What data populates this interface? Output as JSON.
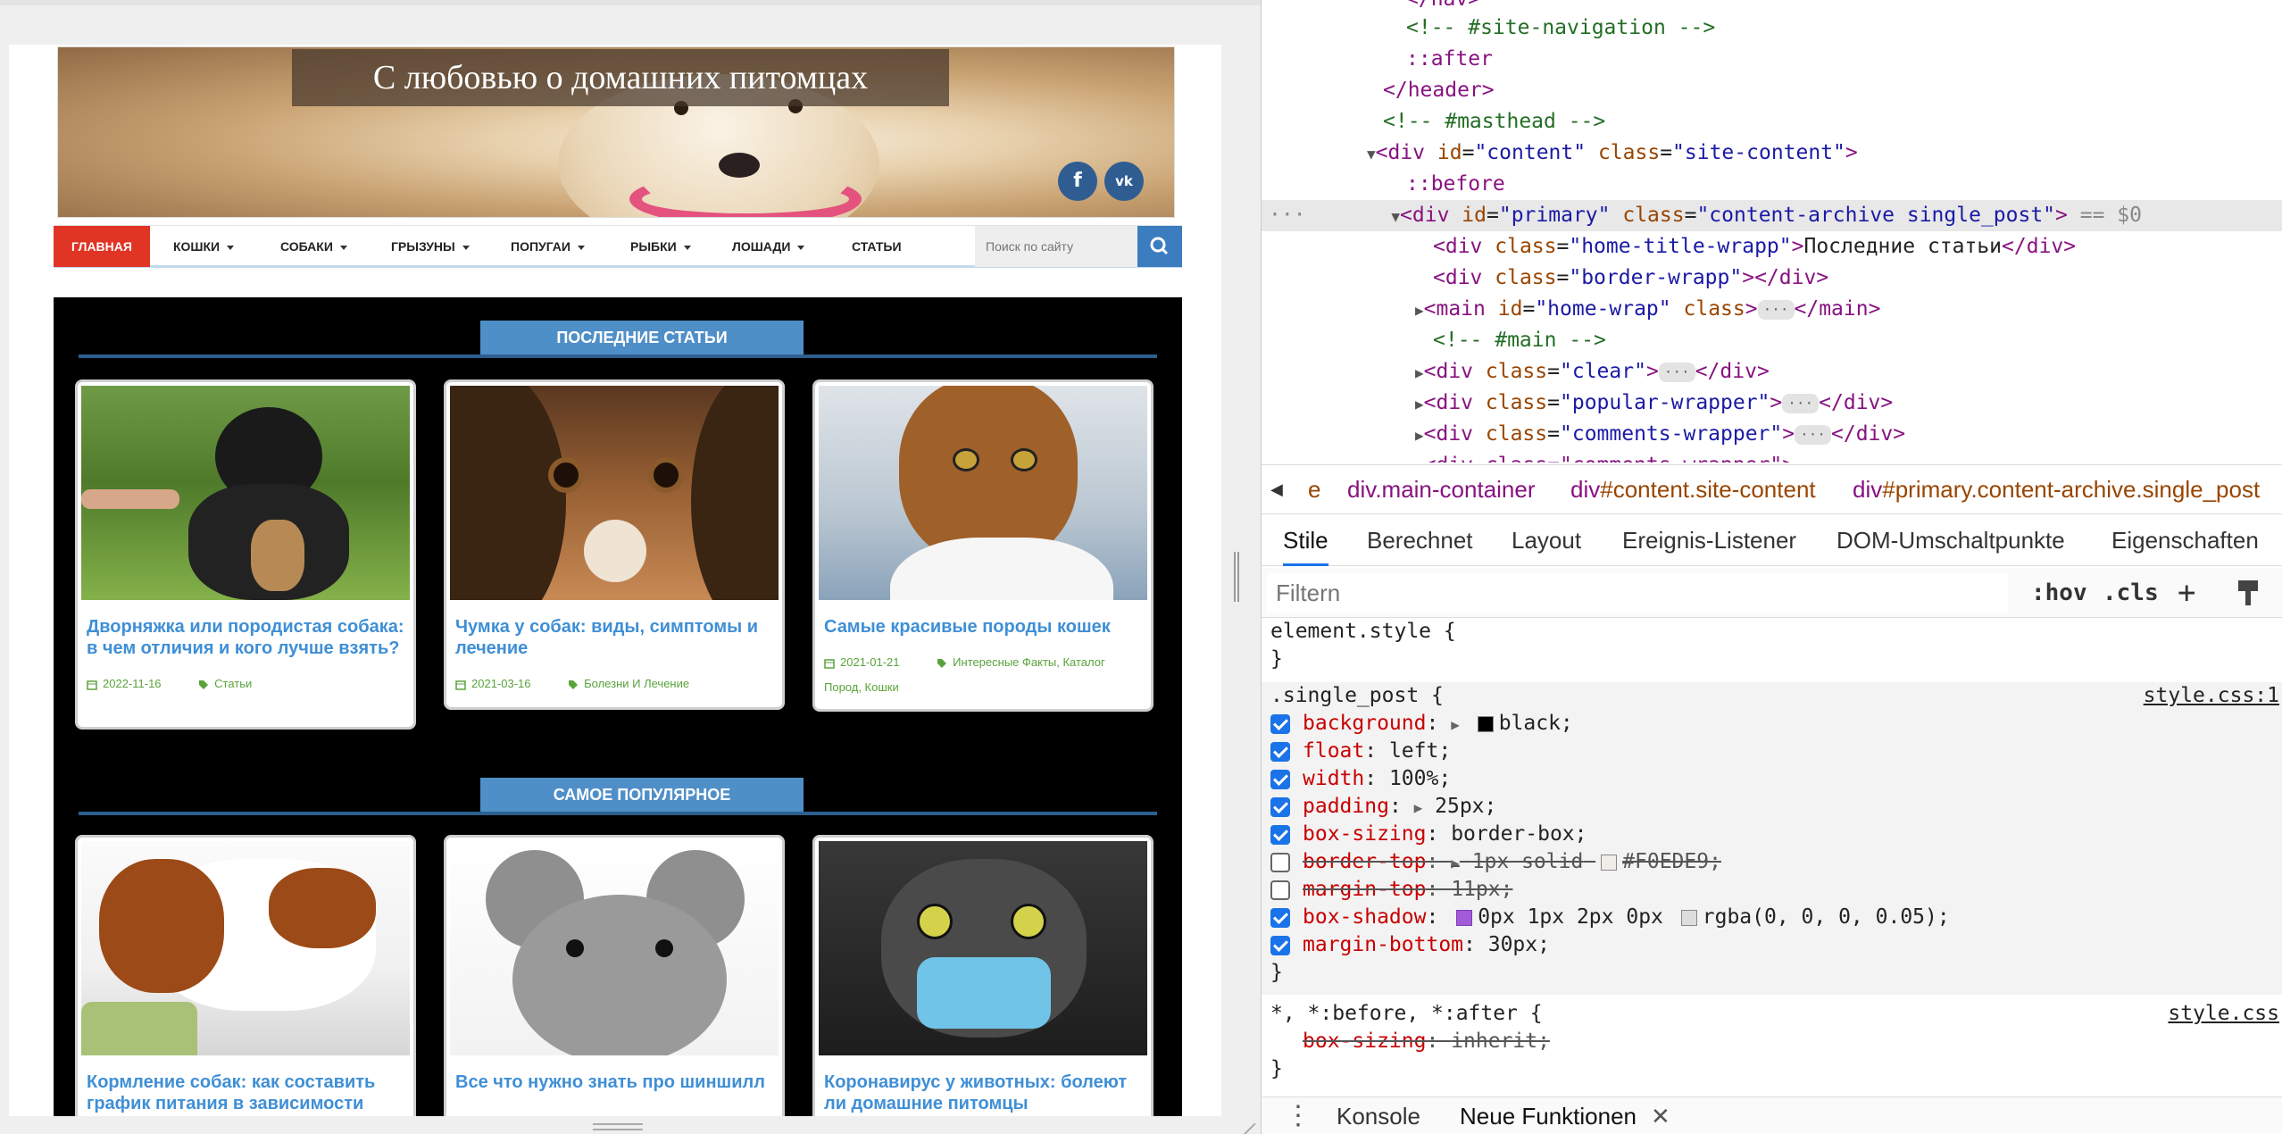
{
  "site": {
    "title": "С любовью о домашних питомцах",
    "social": {
      "fb": "f",
      "vk": "vk"
    },
    "nav": {
      "home": "Главная",
      "items": [
        "Кошки",
        "Собаки",
        "Грызуны",
        "Попугаи",
        "Рыбки",
        "Лошади",
        "Статьи"
      ],
      "search_placeholder": "Поиск по сайту"
    },
    "sections": {
      "latest": "ПОСЛЕДНИЕ СТАТЬИ",
      "popular": "САМОЕ ПОПУЛЯРНОЕ"
    },
    "cards": [
      {
        "title": "Дворняжка или породистая собака: в чем отличия и кого лучше взять?",
        "date": "2022-11-16",
        "category": "Статьи"
      },
      {
        "title": "Чумка у собак: виды, симптомы и лечение",
        "date": "2021-03-16",
        "category": "Болезни И Лечение"
      },
      {
        "title": "Самые красивые породы кошек",
        "date": "2021-01-21",
        "category": "Интересные Факты, Каталог Пород, Кошки"
      },
      {
        "title": "Кормление собак: как составить график питания в зависимости",
        "date": "",
        "category": ""
      },
      {
        "title": "Все что нужно знать про шиншилл",
        "date": "",
        "category": ""
      },
      {
        "title": "Коронавирус у животных: болеют ли домашние питомцы",
        "date": "",
        "category": ""
      }
    ]
  },
  "devtools": {
    "dom": {
      "l0": "</nav>",
      "l1": "<!-- #site-navigation -->",
      "l2": "::after",
      "l3": "</header>",
      "l4": "<!-- #masthead -->",
      "l5_tag": "<div",
      "l5_a1": "id",
      "l5_v1": "\"content\"",
      "l5_a2": "class",
      "l5_v2": "\"site-content\"",
      "l6": "::before",
      "l7_a1": "id",
      "l7_v1": "\"primary\"",
      "l7_a2": "class",
      "l7_v2": "\"content-archive single_post\"",
      "l7_eq": "== $0",
      "l8_v": "\"home-title-wrapp\"",
      "l8_text": "Последние статьи",
      "l9_v": "\"border-wrapp\"",
      "l10_a1": "id",
      "l10_v1": "\"home-wrap\"",
      "l10_a2": "class",
      "l11": "<!-- #main -->",
      "l12_v": "\"clear\"",
      "l13_v": "\"popular-wrapper\"",
      "l14_v": "\"comments-wrapper\"",
      "l15": "<div class=\"comments-wrapper\">"
    },
    "breadcrumbs": [
      {
        "tag": "e",
        "cls": ""
      },
      {
        "tag": "div",
        "cls": ".main-container"
      },
      {
        "tag": "div",
        "cls": "#content.site-content"
      },
      {
        "tag": "div",
        "cls": "#primary.content-archive.single_post"
      }
    ],
    "tabs": [
      "Stile",
      "Berechnet",
      "Layout",
      "Ereignis-Listener",
      "DOM-Umschaltpunkte",
      "Eigenschaften"
    ],
    "filter_placeholder": "Filtern",
    "hov": ":hov",
    "cls": ".cls",
    "element_style": "element.style {",
    "close_brace": "}",
    "rule1_selector": ".single_post {",
    "rule1_source": "style.css:1",
    "props": [
      {
        "name": "background",
        "value": "black;",
        "on": true,
        "swatch": "#000000"
      },
      {
        "name": "float",
        "value": "left;",
        "on": true
      },
      {
        "name": "width",
        "value": "100%;",
        "on": true
      },
      {
        "name": "padding",
        "value": "25px;",
        "on": true
      },
      {
        "name": "box-sizing",
        "value": "border-box;",
        "on": true
      },
      {
        "name": "border-top",
        "value": "1px solid",
        "value2": "#F0EDE9;",
        "on": false,
        "swatch": "#F0EDE9"
      },
      {
        "name": "margin-top",
        "value": "11px;",
        "on": false
      },
      {
        "name": "box-shadow",
        "value": "0px 1px 2px 0px",
        "value2": "rgba(0, 0, 0, 0.05);",
        "on": true
      },
      {
        "name": "margin-bottom",
        "value": "30px;",
        "on": true
      }
    ],
    "rule2_selector": "*, *:before, *:after {",
    "rule2_source": "style.css",
    "rule2_prop": "box-sizing",
    "rule2_val": "inherit;",
    "console_tabs": [
      "Konsole",
      "Neue Funktionen"
    ]
  }
}
